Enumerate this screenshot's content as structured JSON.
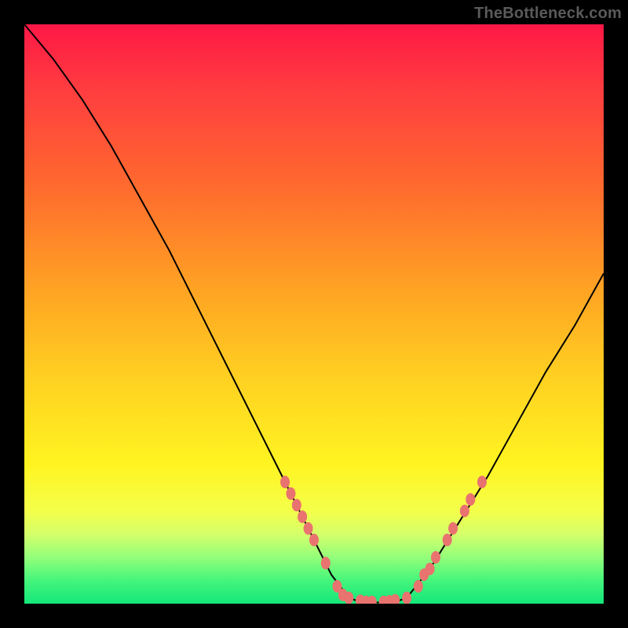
{
  "watermark": "TheBottleneck.com",
  "colors": {
    "curve": "#000000",
    "marker": "#e9736f",
    "background_black": "#000000"
  },
  "chart_data": {
    "type": "line",
    "title": "",
    "xlabel": "",
    "ylabel": "",
    "xlim": [
      0,
      100
    ],
    "ylim": [
      0,
      100
    ],
    "grid": false,
    "legend": "none",
    "series": [
      {
        "name": "left-branch",
        "x": [
          0,
          5,
          10,
          15,
          20,
          25,
          30,
          35,
          40,
          45,
          50,
          53,
          56
        ],
        "y": [
          100,
          94,
          87,
          79,
          70,
          61,
          51,
          41,
          31,
          21,
          11,
          5,
          1
        ]
      },
      {
        "name": "valley-floor",
        "x": [
          56,
          58,
          60,
          62,
          64,
          66
        ],
        "y": [
          1,
          0.3,
          0.2,
          0.2,
          0.3,
          1
        ]
      },
      {
        "name": "right-branch",
        "x": [
          66,
          70,
          75,
          80,
          85,
          90,
          95,
          100
        ],
        "y": [
          1,
          6,
          14,
          22,
          31,
          40,
          48,
          57
        ]
      }
    ],
    "markers": {
      "name": "dotted-band",
      "color": "#e9736f",
      "points": [
        {
          "x": 45,
          "y": 21
        },
        {
          "x": 46,
          "y": 19
        },
        {
          "x": 47,
          "y": 17
        },
        {
          "x": 48,
          "y": 15
        },
        {
          "x": 49,
          "y": 13
        },
        {
          "x": 50,
          "y": 11
        },
        {
          "x": 52,
          "y": 7
        },
        {
          "x": 54,
          "y": 3
        },
        {
          "x": 55,
          "y": 1.5
        },
        {
          "x": 56,
          "y": 1
        },
        {
          "x": 58,
          "y": 0.5
        },
        {
          "x": 59,
          "y": 0.3
        },
        {
          "x": 60,
          "y": 0.3
        },
        {
          "x": 62,
          "y": 0.3
        },
        {
          "x": 63,
          "y": 0.4
        },
        {
          "x": 64,
          "y": 0.6
        },
        {
          "x": 66,
          "y": 1
        },
        {
          "x": 68,
          "y": 3
        },
        {
          "x": 69,
          "y": 5
        },
        {
          "x": 70,
          "y": 6
        },
        {
          "x": 71,
          "y": 8
        },
        {
          "x": 73,
          "y": 11
        },
        {
          "x": 74,
          "y": 13
        },
        {
          "x": 76,
          "y": 16
        },
        {
          "x": 77,
          "y": 18
        },
        {
          "x": 79,
          "y": 21
        }
      ]
    }
  }
}
